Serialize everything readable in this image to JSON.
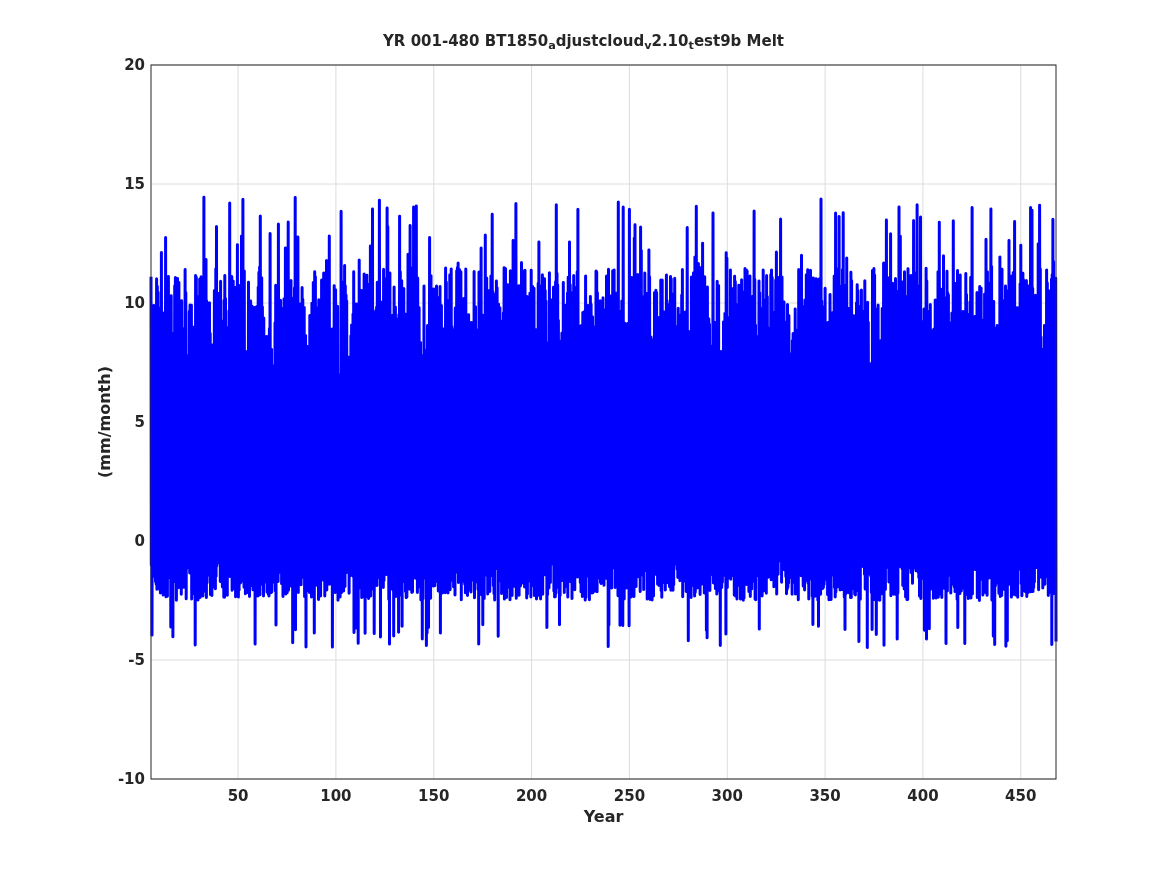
{
  "figure": {
    "title": "YR 001-480 BT1850$_{a}$djustcloud$_{v}$2.10$_{t}$est9b Melt",
    "yticks": [
      "20",
      "15",
      "10",
      "5",
      "0",
      "-5",
      "-10"
    ],
    "ylabel": "(mm/month)",
    "xticks": [
      "50",
      "100",
      "150",
      "200",
      "250",
      "300",
      "350",
      "400",
      "450"
    ],
    "xlabel": "Year",
    "series": [
      {
        "color": "#0000ff"
      }
    ]
  }
}
